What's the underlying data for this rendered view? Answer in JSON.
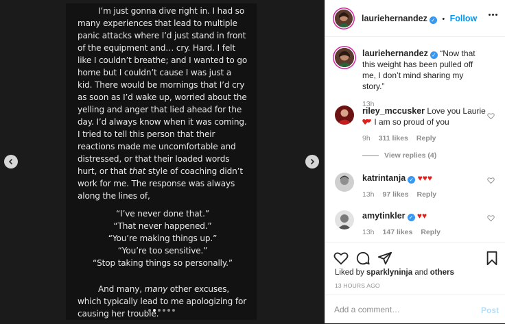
{
  "post_text": {
    "para1": "I’m just gonna dive right in. I had so many experiences that lead to multiple panic attacks where I’d just stand in front of the equipment and… cry. Hard. I felt like I couldn’t breathe; and I wanted to go home but I couldn’t cause I was just a kid. There would be mornings that I’d cry as soon as I’d wake up, worried about the yelling and anger that lied ahead for the day. I’d always know when it was coming. I tried to tell this person that their reactions made me uncomfortable and distressed, or that their loaded words hurt, or that",
    "italic1": "that",
    "para1_tail": " style of coaching didn’t work for me. The response was always along the lines of,",
    "quotes": [
      "“I’ve never done that.”",
      "“That never happened.”",
      "“You’re making things up.”",
      "“You’re too sensitive.”",
      "“Stop taking things so personally.”"
    ],
    "para2_start": "And many, ",
    "italic2": "many",
    "para2_tail": " other excuses, which typically lead to me apologizing for causing her trouble."
  },
  "carousel": {
    "dot_count": 6,
    "active_index": 1
  },
  "header": {
    "username": "lauriehernandez",
    "separator": "•",
    "follow_label": "Follow"
  },
  "caption": {
    "username": "lauriehernandez",
    "text": "“Now that this weight has been pulled off me, I don’t mind sharing my story.”",
    "time": "13h"
  },
  "comments": [
    {
      "username": "riley_mccusker",
      "text_part1": "Love you Laurie",
      "text_part2": " I am so proud of you",
      "time": "9h",
      "likes": "311 likes",
      "reply": "Reply",
      "verified": false
    },
    {
      "username": "katrintanja",
      "text": "♥♥♥",
      "time": "13h",
      "likes": "97 likes",
      "reply": "Reply",
      "verified": true
    },
    {
      "username": "amytinkler",
      "text": "♥♥",
      "time": "13h",
      "likes": "147 likes",
      "reply": "Reply",
      "verified": true
    }
  ],
  "view_replies": "View replies (4)",
  "liked_by": {
    "prefix": "Liked by ",
    "user": "sparklyninja",
    "mid": " and ",
    "others": "others"
  },
  "timestamp": "13 HOURS AGO",
  "add_comment": {
    "placeholder": "Add a comment…",
    "post_label": "Post"
  },
  "colors": {
    "accent": "#0095f6",
    "verified": "#3897f0",
    "heart": "#e0201b"
  }
}
